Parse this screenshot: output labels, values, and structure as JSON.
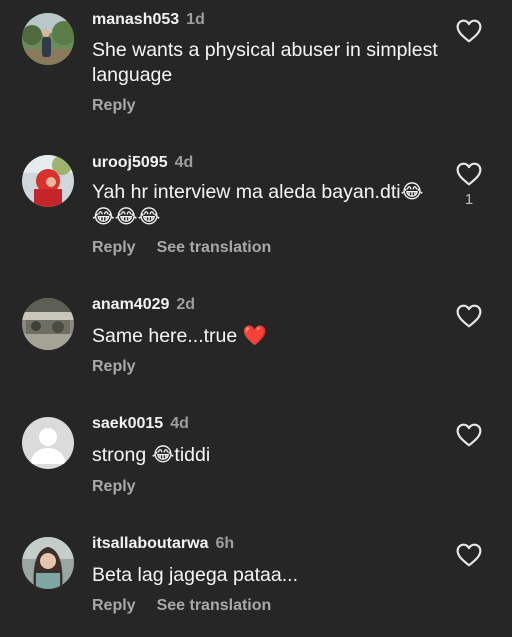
{
  "comments": [
    {
      "username": "manash053",
      "age": "1d",
      "text": "She wants a physical abuser in simplest language",
      "reply": "Reply",
      "avatar": "photo-person-outdoors"
    },
    {
      "username": "urooj5095",
      "age": "4d",
      "text": "Yah hr interview ma aleda bayan.dti😂😂😂😂",
      "reply": "Reply",
      "see_translation": "See translation",
      "likes": "1",
      "avatar": "photo-person-red-scarf"
    },
    {
      "username": "anam4029",
      "age": "2d",
      "text": "Same here...true ❤️",
      "reply": "Reply",
      "avatar": "photo-scenery"
    },
    {
      "username": "saek0015",
      "age": "4d",
      "text": "strong 😂tiddi",
      "reply": "Reply",
      "avatar": "default-avatar"
    },
    {
      "username": "itsallaboutarwa",
      "age": "6h",
      "text": "Beta lag jagega pataa...",
      "reply": "Reply",
      "see_translation": "See translation",
      "avatar": "photo-person-portrait"
    }
  ],
  "icons": {
    "like": "heart-outline-icon"
  },
  "colors": {
    "background": "#262626",
    "primary_text": "#f5f5f5",
    "secondary_text": "#a8a8a8",
    "heart_emoji": "#e0245e"
  }
}
